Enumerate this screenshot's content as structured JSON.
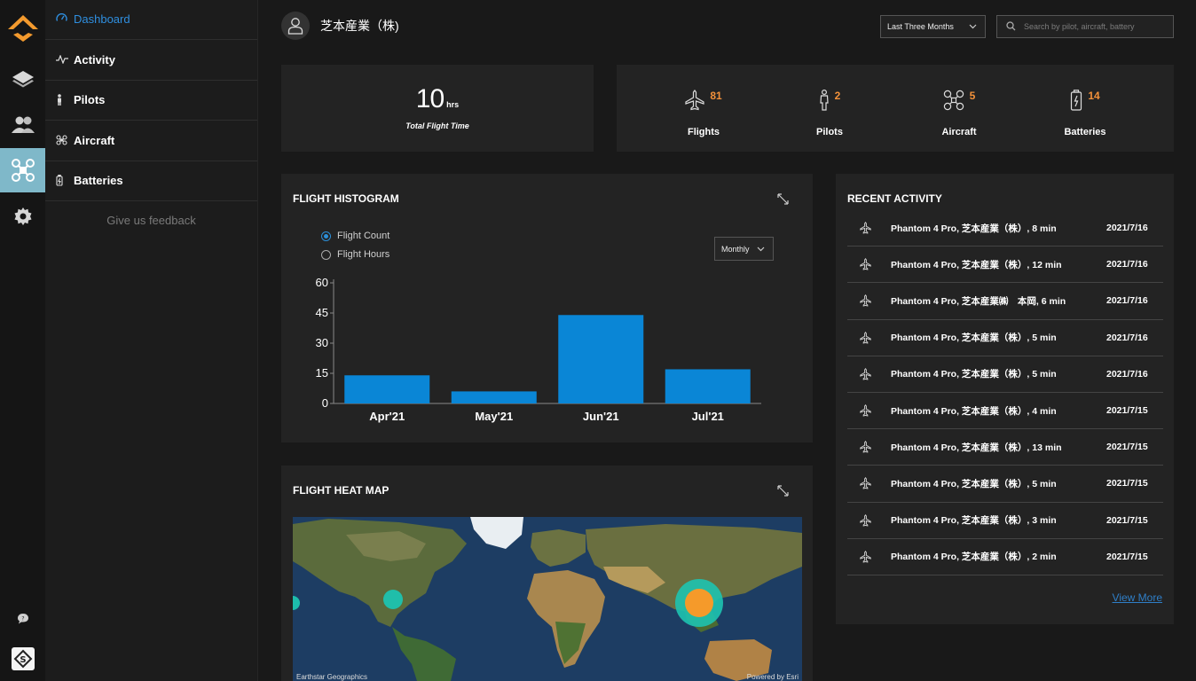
{
  "rail": {
    "items": [
      "logo-icon",
      "layers-icon",
      "users-icon",
      "drone-icon",
      "gear-icon"
    ],
    "active_index": 3,
    "bottom": [
      "chat-icon",
      "brand-badge-icon"
    ]
  },
  "sidenav": {
    "items": [
      {
        "label": "Dashboard",
        "icon": "gauge-icon"
      },
      {
        "label": "Activity",
        "icon": "pulse-icon"
      },
      {
        "label": "Pilots",
        "icon": "pilot-icon"
      },
      {
        "label": "Aircraft",
        "icon": "drone-icon"
      },
      {
        "label": "Batteries",
        "icon": "battery-icon"
      }
    ],
    "active_index": 0,
    "feedback": "Give us feedback"
  },
  "header": {
    "org_name": "芝本産業（株)",
    "period": "Last Three Months",
    "search_placeholder": "Search by pilot, aircraft, battery"
  },
  "summary": {
    "total_value": "10",
    "total_unit": "hrs",
    "total_label": "Total Flight Time",
    "stats": [
      {
        "label": "Flights",
        "value": "81",
        "icon": "plane-icon"
      },
      {
        "label": "Pilots",
        "value": "2",
        "icon": "person-icon"
      },
      {
        "label": "Aircraft",
        "value": "5",
        "icon": "drone-icon"
      },
      {
        "label": "Batteries",
        "value": "14",
        "icon": "battery-icon"
      }
    ],
    "accent": "#f2913a"
  },
  "histogram": {
    "title": "FLIGHT HISTOGRAM",
    "radio": [
      {
        "label": "Flight Count",
        "selected": true
      },
      {
        "label": "Flight Hours",
        "selected": false
      }
    ],
    "interval": "Monthly"
  },
  "chart_data": {
    "type": "bar",
    "categories": [
      "Apr'21",
      "May'21",
      "Jun'21",
      "Jul'21"
    ],
    "values": [
      14,
      6,
      44,
      17
    ],
    "yticks": [
      0,
      15,
      30,
      45,
      60
    ],
    "ylim": [
      0,
      60
    ],
    "bar_color": "#0a86d6",
    "title": "",
    "xlabel": "",
    "ylabel": ""
  },
  "heatmap": {
    "title": "FLIGHT HEAT MAP",
    "credit_left": "Earthstar Geographics",
    "credit_right": "Powered by Esri"
  },
  "recent": {
    "title": "RECENT ACTIVITY",
    "rows": [
      {
        "text": "Phantom 4 Pro, 芝本産業（株）, 8 min",
        "date": "2021/7/16"
      },
      {
        "text": "Phantom 4 Pro, 芝本産業（株）, 12 min",
        "date": "2021/7/16"
      },
      {
        "text": "Phantom 4 Pro, 芝本産業㈱　本岡, 6 min",
        "date": "2021/7/16"
      },
      {
        "text": "Phantom 4 Pro, 芝本産業（株）, 5 min",
        "date": "2021/7/16"
      },
      {
        "text": "Phantom 4 Pro, 芝本産業（株）, 5 min",
        "date": "2021/7/16"
      },
      {
        "text": "Phantom 4 Pro, 芝本産業（株）, 4 min",
        "date": "2021/7/15"
      },
      {
        "text": "Phantom 4 Pro, 芝本産業（株）, 13 min",
        "date": "2021/7/15"
      },
      {
        "text": "Phantom 4 Pro, 芝本産業（株）, 5 min",
        "date": "2021/7/15"
      },
      {
        "text": "Phantom 4 Pro, 芝本産業（株）, 3 min",
        "date": "2021/7/15"
      },
      {
        "text": "Phantom 4 Pro, 芝本産業（株）, 2 min",
        "date": "2021/7/15"
      }
    ],
    "view_more": "View More"
  }
}
